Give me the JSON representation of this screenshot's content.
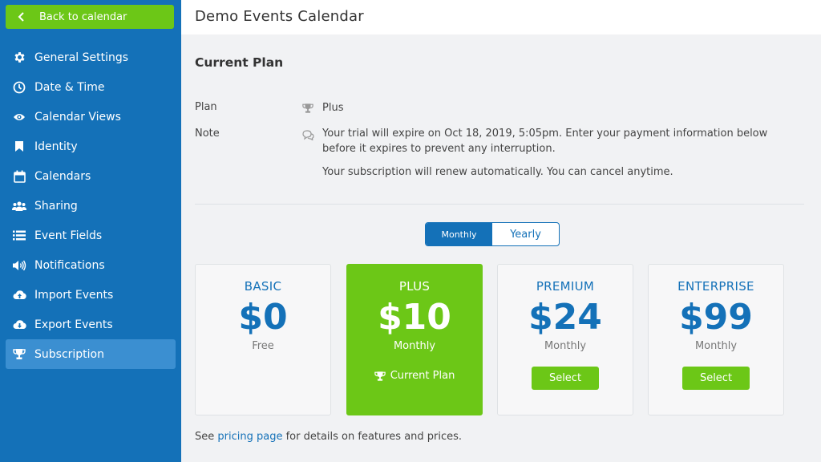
{
  "sidebar": {
    "back_label": "Back to calendar",
    "items": [
      {
        "label": "General Settings",
        "icon": "gear-icon"
      },
      {
        "label": "Date & Time",
        "icon": "clock-icon"
      },
      {
        "label": "Calendar Views",
        "icon": "eye-icon"
      },
      {
        "label": "Identity",
        "icon": "bookmark-icon"
      },
      {
        "label": "Calendars",
        "icon": "calendar-icon"
      },
      {
        "label": "Sharing",
        "icon": "users-icon"
      },
      {
        "label": "Event Fields",
        "icon": "list-icon"
      },
      {
        "label": "Notifications",
        "icon": "volume-icon"
      },
      {
        "label": "Import Events",
        "icon": "cloud-upload-icon"
      },
      {
        "label": "Export Events",
        "icon": "cloud-download-icon"
      },
      {
        "label": "Subscription",
        "icon": "trophy-icon",
        "active": true
      }
    ]
  },
  "header": {
    "title": "Demo Events Calendar"
  },
  "current_plan": {
    "title": "Current Plan",
    "plan_label": "Plan",
    "plan_value": "Plus",
    "note_label": "Note",
    "note_line1": "Your trial will expire on Oct 18, 2019, 5:05pm. Enter your payment information below before it expires to prevent any interruption.",
    "note_line2": "Your subscription will renew automatically. You can cancel anytime."
  },
  "billing_toggle": {
    "monthly": "Monthly",
    "yearly": "Yearly",
    "selected": "Monthly"
  },
  "plans": [
    {
      "name": "BASIC",
      "price": "$0",
      "period": "Free",
      "action": ""
    },
    {
      "name": "PLUS",
      "price": "$10",
      "period": "Monthly",
      "action": "Current Plan",
      "current": true
    },
    {
      "name": "PREMIUM",
      "price": "$24",
      "period": "Monthly",
      "action": "Select"
    },
    {
      "name": "ENTERPRISE",
      "price": "$99",
      "period": "Monthly",
      "action": "Select"
    }
  ],
  "footer": {
    "prefix": "See",
    "link": "pricing page",
    "suffix": "for details on features and prices."
  },
  "colors": {
    "sidebar": "#1471b8",
    "accent_green": "#6cc717",
    "primary_blue": "#1471b8",
    "active_item": "#3b8fd1"
  }
}
